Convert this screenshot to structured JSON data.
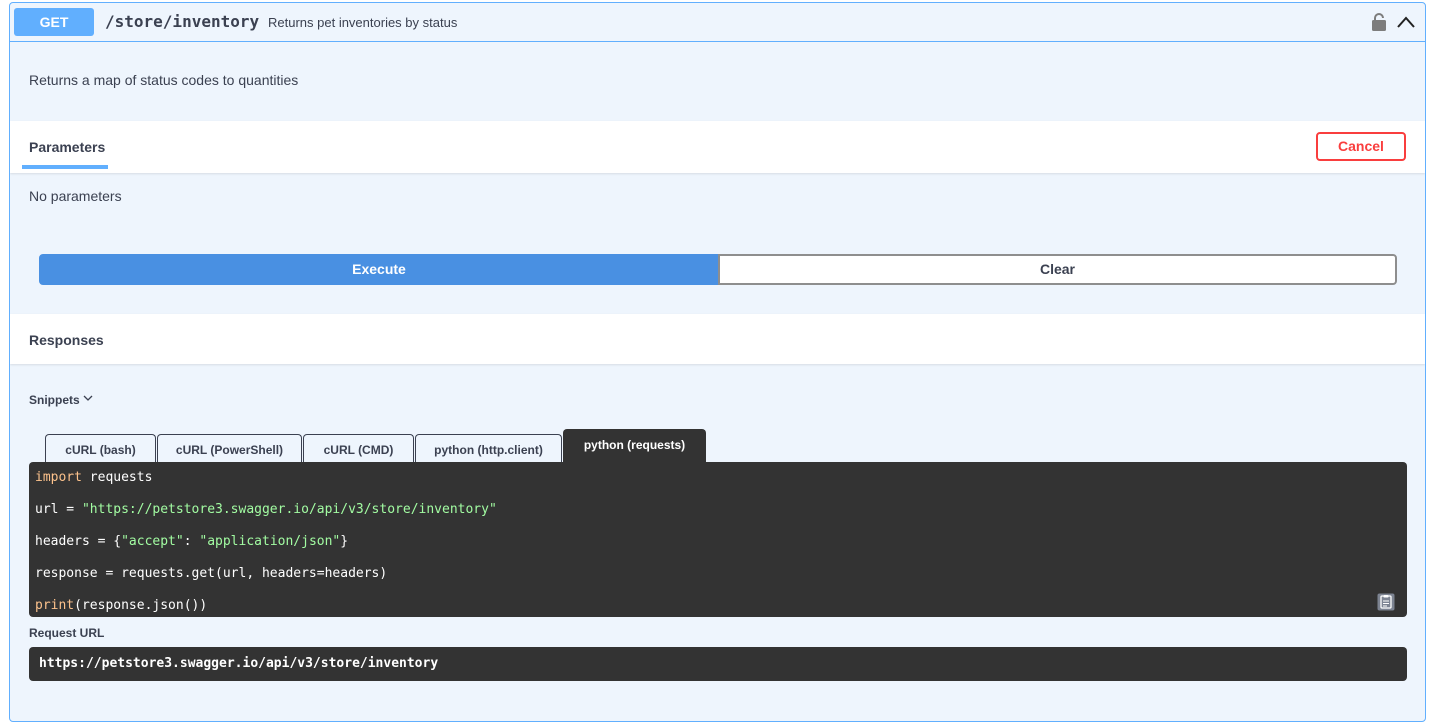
{
  "operation": {
    "method": "GET",
    "path": "/store/inventory",
    "summary": "Returns pet inventories by status",
    "description": "Returns a map of status codes to quantities",
    "method_color": "#61affe"
  },
  "parameters": {
    "tab_label": "Parameters",
    "cancel_label": "Cancel",
    "empty_text": "No parameters"
  },
  "actions": {
    "execute_label": "Execute",
    "clear_label": "Clear"
  },
  "responses": {
    "title": "Responses"
  },
  "snippets": {
    "label": "Snippets",
    "tabs": [
      {
        "label": "cURL (bash)"
      },
      {
        "label": "cURL (PowerShell)"
      },
      {
        "label": "cURL (CMD)"
      },
      {
        "label": "python (http.client)"
      },
      {
        "label": "python (requests)",
        "active": true
      }
    ],
    "code": {
      "line1_kw": "import",
      "line1_rest": " requests",
      "line2_pre": "url = ",
      "line2_str": "\"https://petstore3.swagger.io/api/v3/store/inventory\"",
      "line3_pre": "headers = {",
      "line3_key": "\"accept\"",
      "line3_sep": ": ",
      "line3_val": "\"application/json\"",
      "line3_post": "}",
      "line4": "response = requests.get(url, headers=headers)",
      "line5_fn": "print",
      "line5_rest": "(response.json())"
    }
  },
  "request_url": {
    "label": "Request URL",
    "value": "https://petstore3.swagger.io/api/v3/store/inventory"
  },
  "icons": {
    "lock": "lock-icon",
    "collapse": "chevron-up-icon",
    "snippets_toggle": "chevron-down-icon",
    "copy": "clipboard-icon"
  }
}
